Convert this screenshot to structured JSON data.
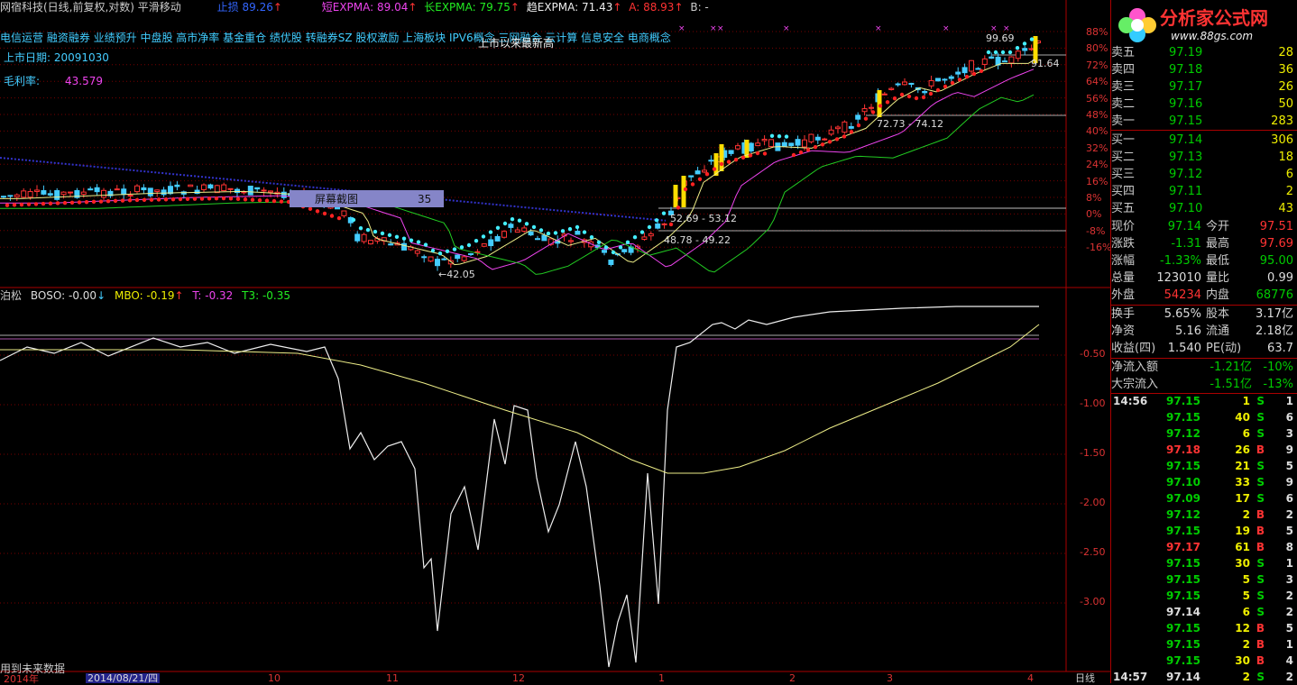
{
  "header": {
    "title": "网宿科技(日线,前复权,对数) 平滑移动",
    "zhisun_label": "止损",
    "zhisun_value": "89.26",
    "short_expma": "短EXPMA: 89.04",
    "long_expma": "长EXPMA: 79.75",
    "trend_expma": "趋EXPMA: 71.43",
    "a_value": "A: 88.93",
    "b_value": "B: -"
  },
  "concepts": "电信运营 融资融券 业绩预升 中盘股 高市净率 基金重仓 绩优股 转融券SZ 股权激励 上海板块 IPV6概念 三网融合 云计算 信息安全 电商概念",
  "listing_date": "上市日期: 20091030",
  "gross_margin_label": "毛利率:",
  "gross_margin_value": "43.579",
  "brand": {
    "logo": "分析家公式网",
    "url": "www.88gs.com"
  },
  "price_axis": [
    "88%",
    "80%",
    "72%",
    "64%",
    "56%",
    "48%",
    "40%",
    "32%",
    "24%",
    "16%",
    "8%",
    "0%",
    "-8%",
    "-16%"
  ],
  "annotations": {
    "high": "99.69",
    "last": "91.64",
    "mid1": "72.73 - 74.12",
    "mid2": "52.69 - 53.12",
    "mid3": "48.78 - 49.22",
    "low": "42.05",
    "screenshot_btn": "屏幕截图",
    "screenshot_val": "35",
    "overlay_text": "上市以来最新高"
  },
  "indicator": {
    "name": "泊松",
    "boso": "BOSO: -0.00",
    "mbo": "MBO: -0.19",
    "t": "T: -0.32",
    "t3": "T3: -0.35",
    "axis": [
      "-0.50",
      "-1.00",
      "-1.50",
      "-2.00",
      "-2.50",
      "-3.00"
    ]
  },
  "footer": {
    "future_note": "用到未来数据",
    "year": "2014年",
    "date": "2014/08/21/四",
    "months": [
      "10",
      "11",
      "12",
      "1",
      "2",
      "3",
      "4"
    ],
    "period": "日线"
  },
  "order_book": {
    "asks": [
      {
        "label": "卖五",
        "price": "97.19",
        "vol": "28"
      },
      {
        "label": "卖四",
        "price": "97.18",
        "vol": "36"
      },
      {
        "label": "卖三",
        "price": "97.17",
        "vol": "26"
      },
      {
        "label": "卖二",
        "price": "97.16",
        "vol": "50"
      },
      {
        "label": "卖一",
        "price": "97.15",
        "vol": "283"
      }
    ],
    "bids": [
      {
        "label": "买一",
        "price": "97.14",
        "vol": "306"
      },
      {
        "label": "买二",
        "price": "97.13",
        "vol": "18"
      },
      {
        "label": "买三",
        "price": "97.12",
        "vol": "6"
      },
      {
        "label": "买四",
        "price": "97.11",
        "vol": "2"
      },
      {
        "label": "买五",
        "price": "97.10",
        "vol": "43"
      }
    ]
  },
  "quote": {
    "rows": [
      [
        "现价",
        "97.14",
        "今开",
        "97.51"
      ],
      [
        "涨跌",
        "-1.31",
        "最高",
        "97.69"
      ],
      [
        "涨幅",
        "-1.33%",
        "最低",
        "95.00"
      ],
      [
        "总量",
        "123010",
        "量比",
        "0.99"
      ],
      [
        "外盘",
        "54234",
        "内盘",
        "68776"
      ]
    ],
    "rows2": [
      [
        "换手",
        "5.65%",
        "股本",
        "3.17亿"
      ],
      [
        "净资",
        "5.16",
        "流通",
        "2.18亿"
      ],
      [
        "收益(四)",
        "1.540",
        "PE(动)",
        "63.7"
      ]
    ],
    "flows": [
      [
        "净流入额",
        "-1.21亿",
        "-10%"
      ],
      [
        "大宗流入",
        "-1.51亿",
        "-13%"
      ]
    ]
  },
  "ticks": [
    {
      "time": "14:56",
      "price": "97.15",
      "vol": "1",
      "side": "S",
      "n": "1"
    },
    {
      "time": "",
      "price": "97.15",
      "vol": "40",
      "side": "S",
      "n": "6"
    },
    {
      "time": "",
      "price": "97.12",
      "vol": "6",
      "side": "S",
      "n": "3"
    },
    {
      "time": "",
      "price": "97.18",
      "vol": "26",
      "side": "B",
      "n": "9"
    },
    {
      "time": "",
      "price": "97.15",
      "vol": "21",
      "side": "S",
      "n": "5"
    },
    {
      "time": "",
      "price": "97.10",
      "vol": "33",
      "side": "S",
      "n": "9"
    },
    {
      "time": "",
      "price": "97.09",
      "vol": "17",
      "side": "S",
      "n": "6"
    },
    {
      "time": "",
      "price": "97.12",
      "vol": "2",
      "side": "B",
      "n": "2"
    },
    {
      "time": "",
      "price": "97.15",
      "vol": "19",
      "side": "B",
      "n": "5"
    },
    {
      "time": "",
      "price": "97.17",
      "vol": "61",
      "side": "B",
      "n": "8"
    },
    {
      "time": "",
      "price": "97.15",
      "vol": "30",
      "side": "S",
      "n": "1"
    },
    {
      "time": "",
      "price": "97.15",
      "vol": "5",
      "side": "S",
      "n": "3"
    },
    {
      "time": "",
      "price": "97.15",
      "vol": "5",
      "side": "S",
      "n": "2"
    },
    {
      "time": "",
      "price": "97.14",
      "vol": "6",
      "side": "S",
      "n": "2"
    },
    {
      "time": "",
      "price": "97.15",
      "vol": "12",
      "side": "B",
      "n": "5"
    },
    {
      "time": "",
      "price": "97.15",
      "vol": "2",
      "side": "B",
      "n": "1"
    },
    {
      "time": "",
      "price": "97.15",
      "vol": "30",
      "side": "B",
      "n": "4"
    },
    {
      "time": "14:57",
      "price": "97.14",
      "vol": "2",
      "side": "S",
      "n": "2"
    }
  ]
}
